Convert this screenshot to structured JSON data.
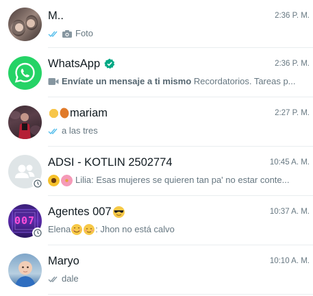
{
  "chats": [
    {
      "name": "M..",
      "time": "2:36 P. M.",
      "preview": "Foto",
      "status": "read",
      "media": "camera-icon",
      "avatar": "photo-two-people"
    },
    {
      "name": "WhatsApp",
      "time": "2:36 P. M.",
      "preview_bold": "Envíate un mensaje a ti mismo",
      "preview": " Recordatorios. Tareas p...",
      "media": "video-icon",
      "verified": true,
      "avatar": "whatsapp-logo"
    },
    {
      "name": "mariam",
      "time": "2:27 P. M.",
      "preview": "a las tres",
      "status": "read",
      "avatar": "photo-person-dark"
    },
    {
      "name": "ADSI - KOTLIN 2502774",
      "time": "10:45 A. M.",
      "preview": "Lilia: Esas mujeres se quieren tan pa' no estar conte...",
      "avatar": "group-placeholder"
    },
    {
      "name": "Agentes 007",
      "time": "10:37 A. M.",
      "preview_sender": "Elena",
      "preview": ": Jhon no está calvo",
      "avatar": "neon-007",
      "avatar_text": "007"
    },
    {
      "name": "Maryo",
      "time": "10:10 A. M.",
      "preview": "dale",
      "status": "delivered",
      "avatar": "photo-baby"
    }
  ],
  "colors": {
    "read_ticks": "#53bdeb",
    "delivered_ticks": "#8696a0",
    "whatsapp_green": "#25d366",
    "verified_green": "#00a884",
    "divider": "#e9edef",
    "secondary_text": "#667781"
  }
}
